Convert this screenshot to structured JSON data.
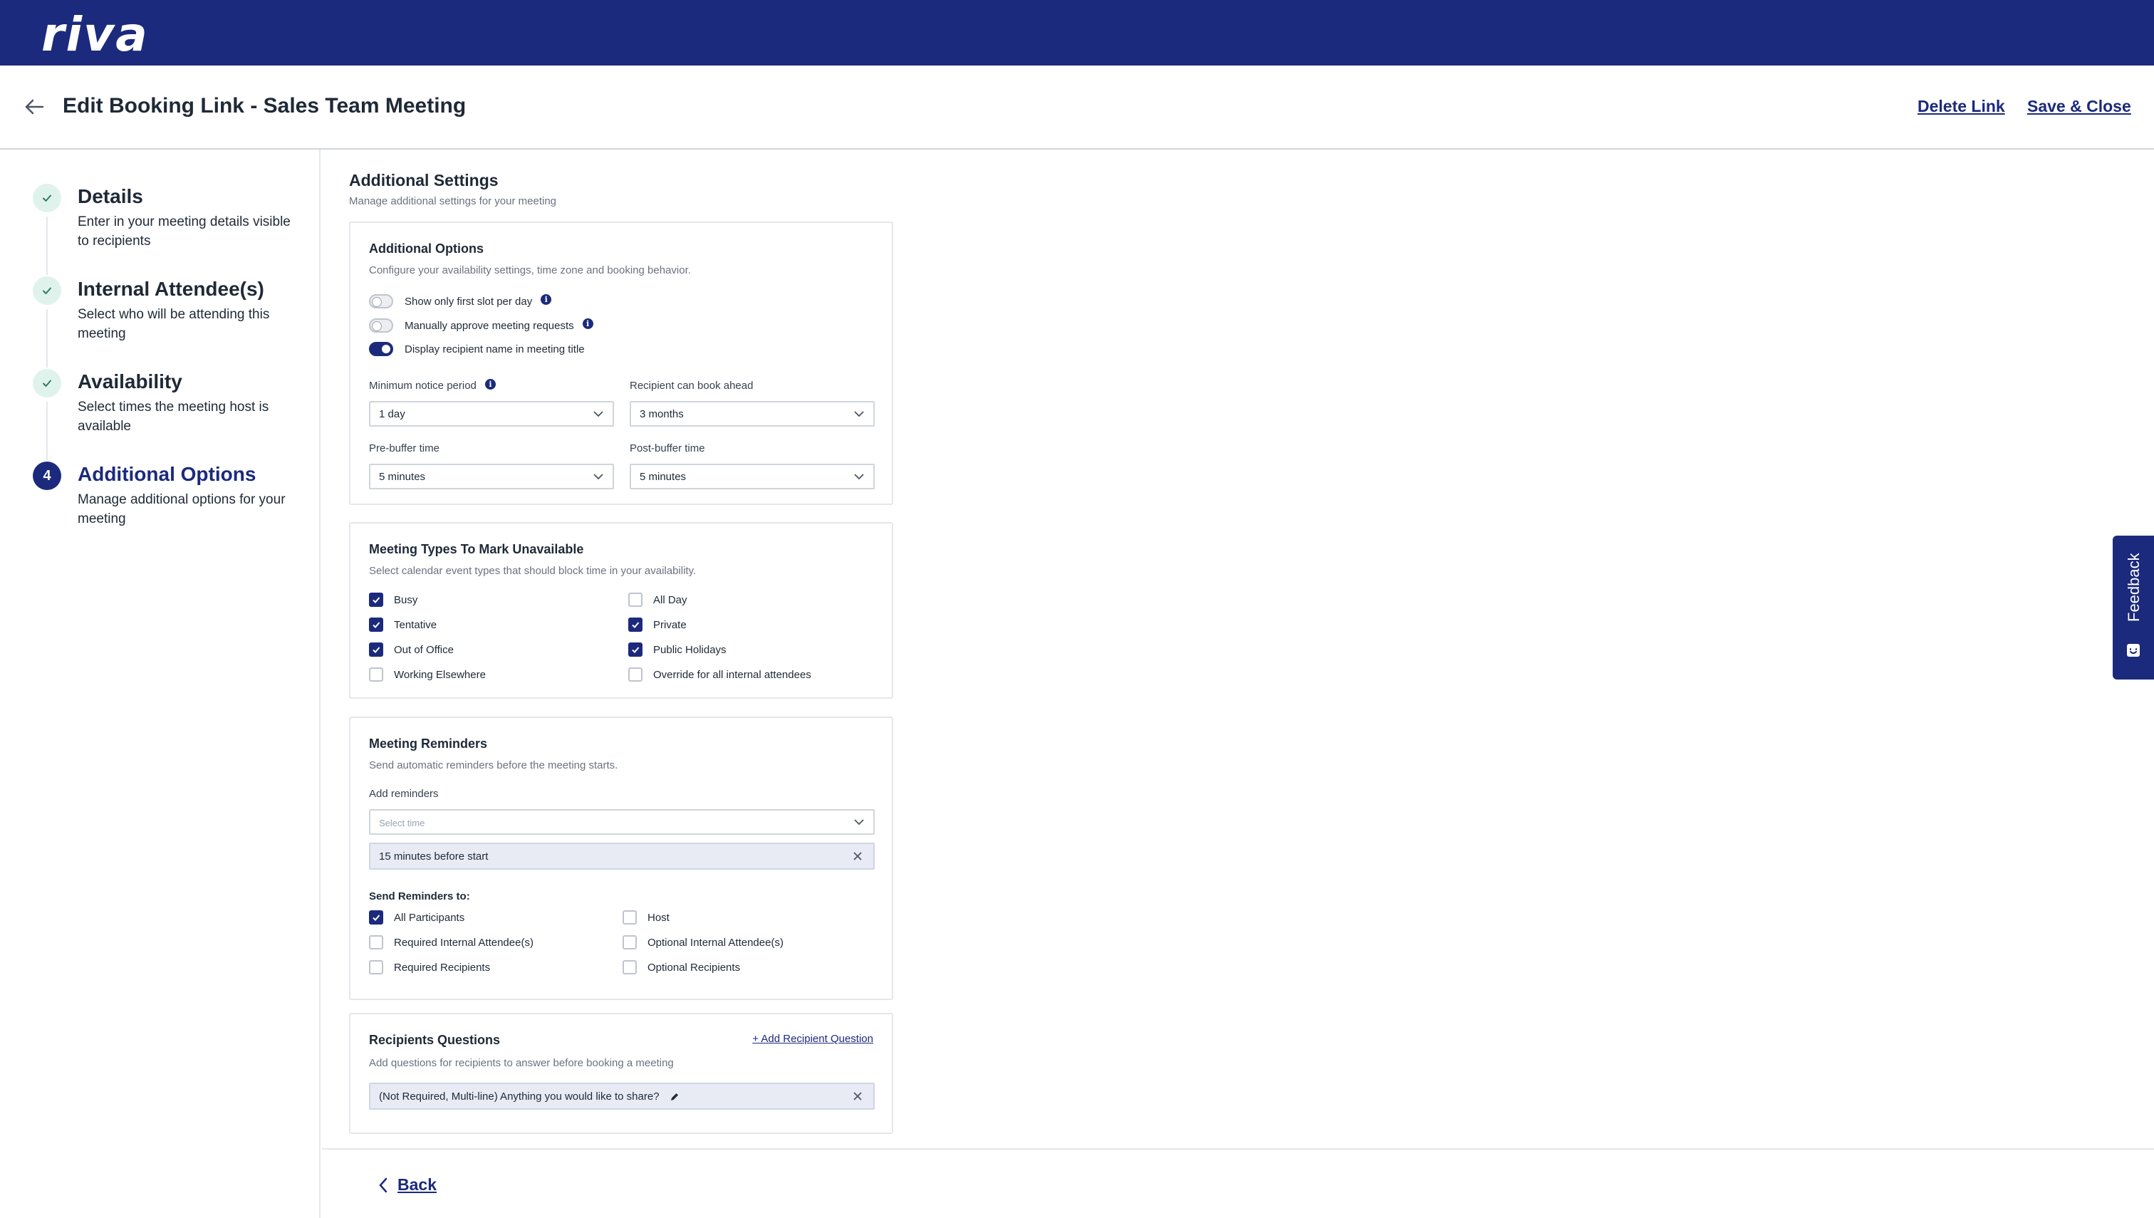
{
  "app": {
    "logo_text": "riva"
  },
  "header": {
    "title": "Edit Booking Link - Sales Team Meeting",
    "delete_label": "Delete Link",
    "save_label": "Save & Close"
  },
  "steps": [
    {
      "title": "Details",
      "desc": "Enter in your meeting details visible to recipients",
      "state": "done"
    },
    {
      "title": "Internal Attendee(s)",
      "desc": "Select who will be attending this meeting",
      "state": "done"
    },
    {
      "title": "Availability",
      "desc": "Select times the meeting host is available",
      "state": "done"
    },
    {
      "number": "4",
      "title": "Additional Options",
      "desc": "Manage additional options for your meeting",
      "state": "active"
    }
  ],
  "main": {
    "title": "Additional Settings",
    "subtitle": "Manage additional settings for your meeting"
  },
  "additional_options": {
    "title": "Additional Options",
    "subtitle": "Configure your availability settings, time zone and booking behavior.",
    "toggles": [
      {
        "label": "Show only first slot per day",
        "on": false,
        "info": true
      },
      {
        "label": "Manually approve meeting requests",
        "on": false,
        "info": true
      },
      {
        "label": "Display recipient name in meeting title",
        "on": true,
        "info": false
      }
    ],
    "min_notice": {
      "label": "Minimum notice period",
      "value": "1 day"
    },
    "book_ahead": {
      "label": "Recipient can book ahead",
      "value": "3 months"
    },
    "pre_buffer": {
      "label": "Pre-buffer time",
      "value": "5 minutes"
    },
    "post_buffer": {
      "label": "Post-buffer time",
      "value": "5 minutes"
    }
  },
  "meeting_types": {
    "title": "Meeting Types To Mark Unavailable",
    "subtitle": "Select calendar event types that should block time in your availability.",
    "left": [
      {
        "label": "Busy",
        "checked": true
      },
      {
        "label": "Tentative",
        "checked": true
      },
      {
        "label": "Out of Office",
        "checked": true
      },
      {
        "label": "Working Elsewhere",
        "checked": false
      }
    ],
    "right": [
      {
        "label": "All Day",
        "checked": false
      },
      {
        "label": "Private",
        "checked": true
      },
      {
        "label": "Public Holidays",
        "checked": true
      },
      {
        "label": "Override for all internal attendees",
        "checked": false
      }
    ]
  },
  "reminders": {
    "title": "Meeting Reminders",
    "subtitle": "Send automatic reminders before the meeting starts.",
    "add_label": "Add reminders",
    "select_placeholder": "Select time",
    "chip": "15 minutes before start",
    "send_to_label": "Send Reminders to:",
    "left": [
      {
        "label": "All Participants",
        "checked": true
      },
      {
        "label": "Required Internal Attendee(s)",
        "checked": false
      },
      {
        "label": "Required Recipients",
        "checked": false
      }
    ],
    "right": [
      {
        "label": "Host",
        "checked": false
      },
      {
        "label": "Optional Internal Attendee(s)",
        "checked": false
      },
      {
        "label": "Optional Recipients",
        "checked": false
      }
    ]
  },
  "questions": {
    "title": "Recipients Questions",
    "add_label": "+ Add Recipient Question",
    "subtitle": "Add questions for recipients to answer before booking a meeting",
    "chip": "(Not Required, Multi-line) Anything you would like to share?"
  },
  "footer": {
    "back_label": "Back"
  },
  "feedback": {
    "label": "Feedback"
  },
  "colors": {
    "brand": "#1b2a7c",
    "step_done_bg": "#dff3ec",
    "check_green": "#2e7d5b"
  }
}
